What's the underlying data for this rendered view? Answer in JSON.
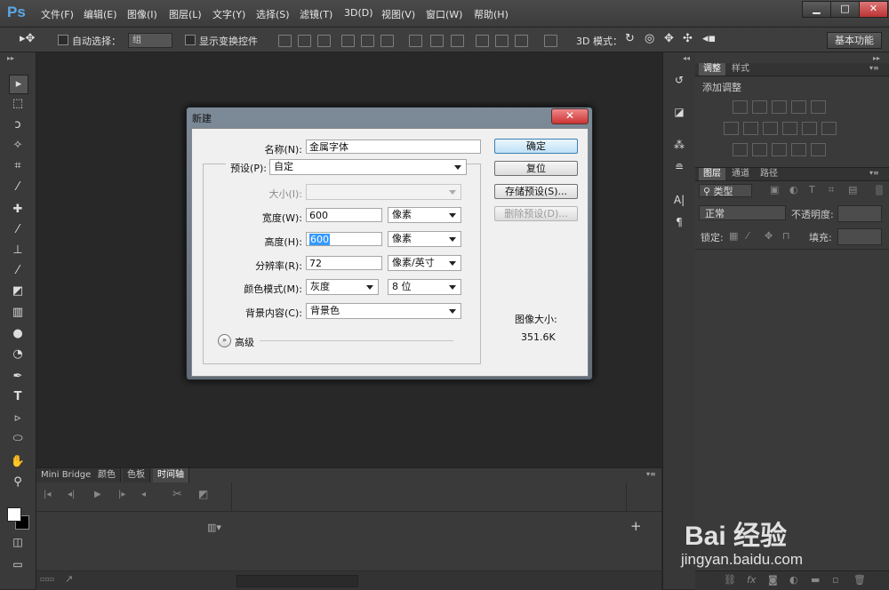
{
  "app": {
    "logo": "Ps"
  },
  "menu": [
    "文件(F)",
    "编辑(E)",
    "图像(I)",
    "图层(L)",
    "文字(Y)",
    "选择(S)",
    "滤镜(T)",
    "3D(D)",
    "视图(V)",
    "窗口(W)",
    "帮助(H)"
  ],
  "window_controls": {
    "minimize": "▁",
    "maximize": "□",
    "close": "✕"
  },
  "options_bar": {
    "auto_select_label": "自动选择：",
    "auto_select_value": "组",
    "show_transform_label": "显示变换控件",
    "mode_3d_label": "3D 模式：",
    "workspace": "基本功能"
  },
  "bottom_tabs": [
    "Mini Bridge",
    "颜色",
    "色板",
    "时间轴"
  ],
  "right_panel": {
    "tabs_top": [
      "调整",
      "样式"
    ],
    "add_adjustment": "添加调整",
    "tabs_layers": [
      "图层",
      "通道",
      "路径"
    ],
    "filter_kind": "类型",
    "blend_mode": "正常",
    "opacity_label": "不透明度:",
    "lock_label": "锁定:",
    "fill_label": "填充:"
  },
  "dialog": {
    "title": "新建",
    "close": "✕",
    "name_label": "名称(N):",
    "name_value": "金属字体",
    "preset_label": "预设(P):",
    "preset_value": "自定",
    "size_label": "大小(I):",
    "width_label": "宽度(W):",
    "width_value": "600",
    "width_unit": "像素",
    "height_label": "高度(H):",
    "height_value": "600",
    "height_unit": "像素",
    "resolution_label": "分辨率(R):",
    "resolution_value": "72",
    "resolution_unit": "像素/英寸",
    "color_mode_label": "颜色模式(M):",
    "color_mode_value": "灰度",
    "bit_depth": "8 位",
    "background_label": "背景内容(C):",
    "background_value": "背景色",
    "advanced_label": "高级",
    "btn_ok": "确定",
    "btn_reset": "复位",
    "btn_save_preset": "存储预设(S)...",
    "btn_delete_preset": "删除预设(D)...",
    "image_size_label": "图像大小:",
    "image_size_value": "351.6K"
  },
  "watermark": {
    "logo": "Bai 经验",
    "url": "jingyan.baidu.com"
  }
}
